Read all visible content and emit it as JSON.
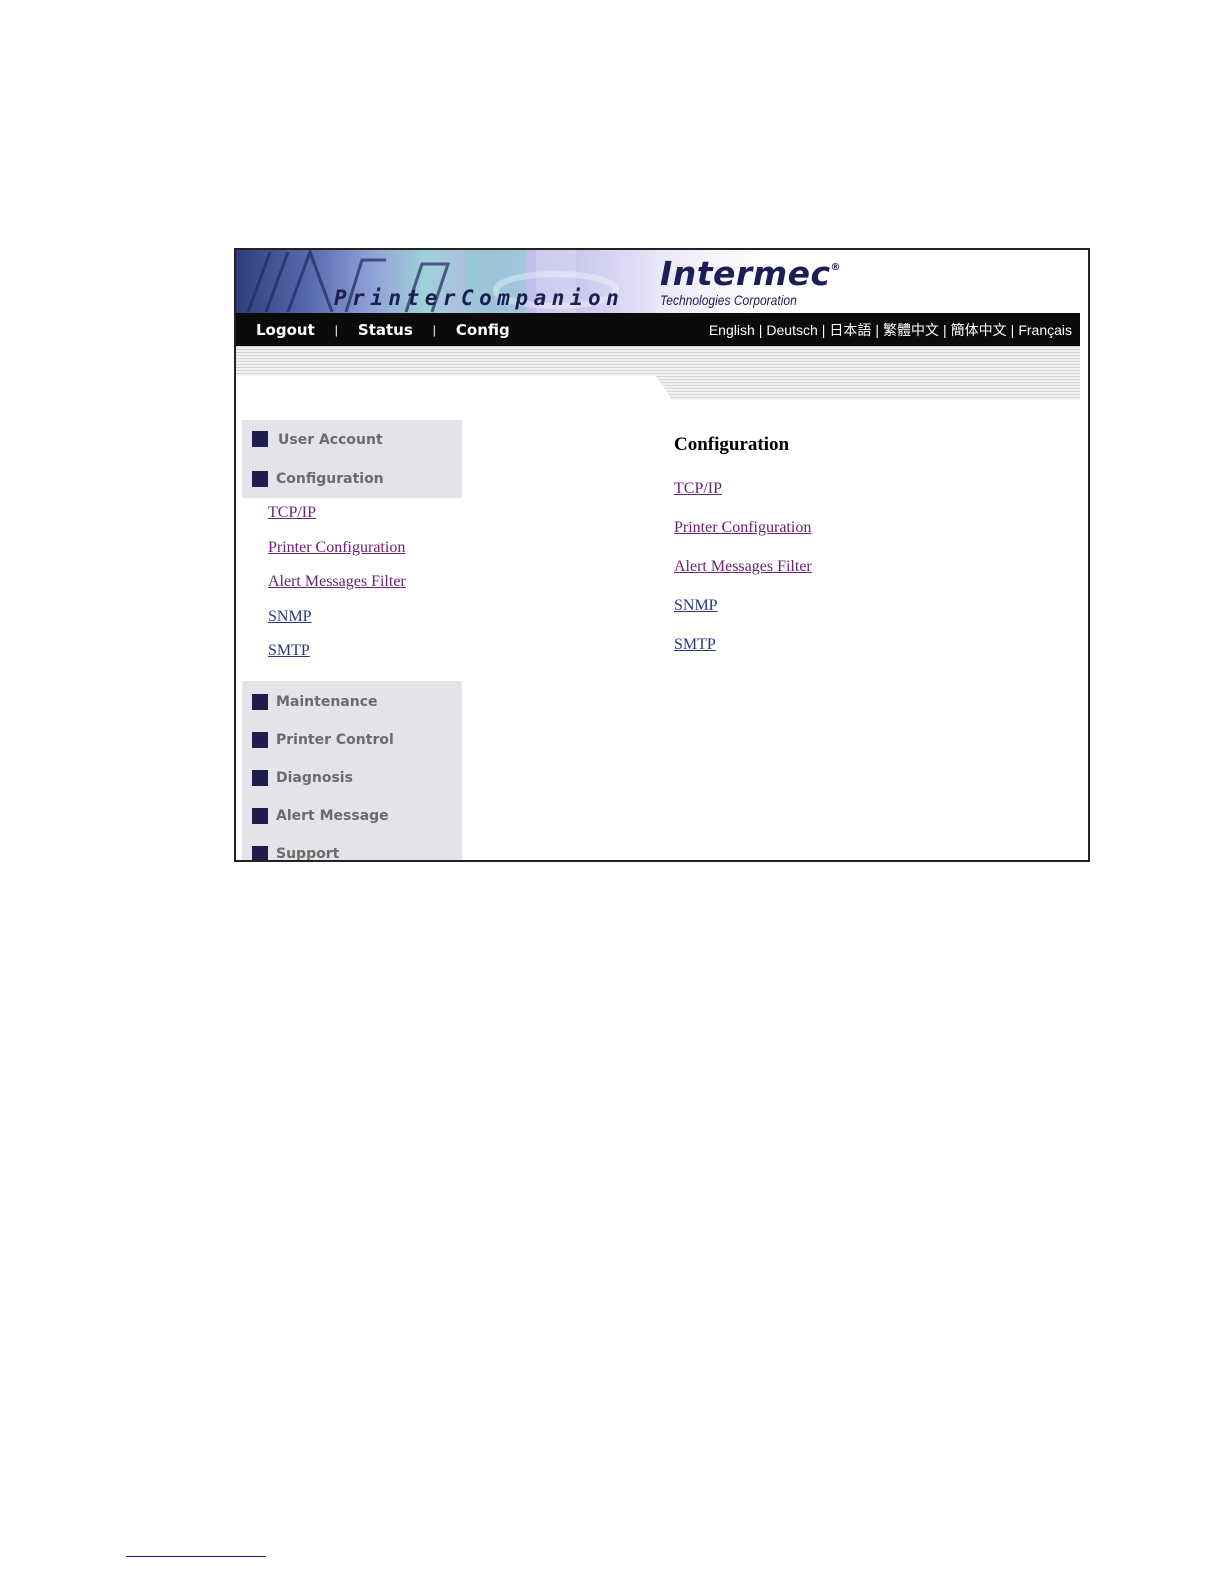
{
  "banner": {
    "product_name": "PrinterCompanion",
    "logo_text": "Intermec",
    "logo_registered": "®",
    "logo_subtitle": "Technologies Corporation"
  },
  "navbar": {
    "left": [
      {
        "label": "Logout"
      },
      {
        "label": "Status"
      },
      {
        "label": "Config"
      }
    ],
    "separator": "|",
    "languages": [
      {
        "label": "English"
      },
      {
        "label": "Deutsch"
      },
      {
        "label": "日本語"
      },
      {
        "label": "繁體中文"
      },
      {
        "label": "簡体中文"
      },
      {
        "label": "Français"
      }
    ]
  },
  "sidebar": {
    "items": [
      {
        "label": "User Account"
      },
      {
        "label": "Configuration"
      },
      {
        "label": "Maintenance"
      },
      {
        "label": "Printer Control"
      },
      {
        "label": "Diagnosis"
      },
      {
        "label": "Alert Message"
      },
      {
        "label": "Support"
      }
    ],
    "configuration_links": [
      {
        "label": "TCP/IP"
      },
      {
        "label": "Printer Configuration"
      },
      {
        "label": "Alert Messages Filter"
      },
      {
        "label": "SNMP"
      },
      {
        "label": "SMTP"
      }
    ]
  },
  "main": {
    "title": "Configuration",
    "links": [
      {
        "label": "TCP/IP"
      },
      {
        "label": "Printer Configuration"
      },
      {
        "label": "Alert Messages Filter"
      },
      {
        "label": "SNMP"
      },
      {
        "label": "SMTP"
      }
    ]
  },
  "colors": {
    "visited_link": "#6a2272",
    "link": "#2b3580",
    "sidebar_bg": "#e4e3e9",
    "bullet": "#201c4d",
    "navbar_bg": "#0b0b0b"
  }
}
